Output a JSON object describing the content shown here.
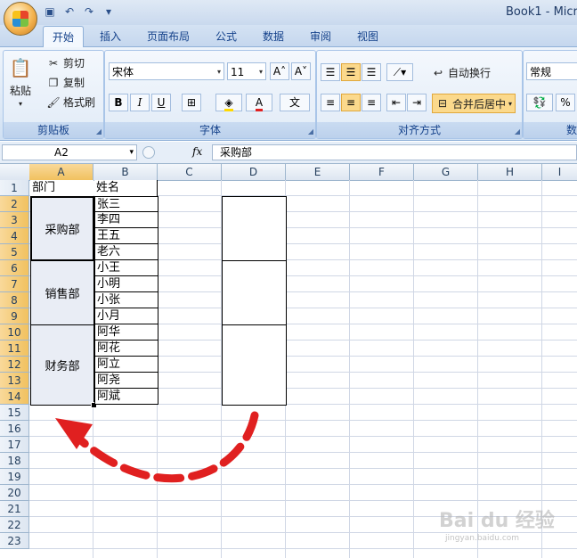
{
  "window": {
    "title": "Book1 - Micr"
  },
  "tabs": [
    "开始",
    "插入",
    "页面布局",
    "公式",
    "数据",
    "审阅",
    "视图"
  ],
  "active_tab": "开始",
  "clipboard": {
    "paste": "粘贴",
    "cut": "剪切",
    "copy": "复制",
    "format_painter": "格式刷",
    "group_label": "剪贴板"
  },
  "font": {
    "name": "宋体",
    "size": "11",
    "bold": "B",
    "italic": "I",
    "underline": "U",
    "group_label": "字体"
  },
  "alignment": {
    "wrap_text": "自动换行",
    "merge_center": "合并后居中",
    "group_label": "对齐方式"
  },
  "number": {
    "format": "常规",
    "percent": "%",
    "group_label_partial": "数"
  },
  "formula_bar": {
    "name_box": "A2",
    "fx": "fx",
    "content": "采购部"
  },
  "columns": [
    "A",
    "B",
    "C",
    "D",
    "E",
    "F",
    "G",
    "H",
    "I"
  ],
  "rows": [
    "1",
    "2",
    "3",
    "4",
    "5",
    "6",
    "7",
    "8",
    "9",
    "10",
    "11",
    "12",
    "13",
    "14",
    "15",
    "16",
    "17",
    "18",
    "19",
    "20",
    "21",
    "22",
    "23"
  ],
  "sheet": {
    "a1": "部门",
    "b1": "姓名",
    "departments": [
      "采购部",
      "销售部",
      "财务部"
    ],
    "names": [
      "张三",
      "李四",
      "王五",
      "老六",
      "小王",
      "小明",
      "小张",
      "小月",
      "阿华",
      "阿花",
      "阿立",
      "阿尧",
      "阿斌"
    ]
  },
  "watermark": {
    "text": "Bai du 经验",
    "sub": "jingyan.baidu.com"
  },
  "colors": {
    "accent": "#15428b",
    "arrow": "#e02020",
    "selected_header": "#f1c15f"
  }
}
